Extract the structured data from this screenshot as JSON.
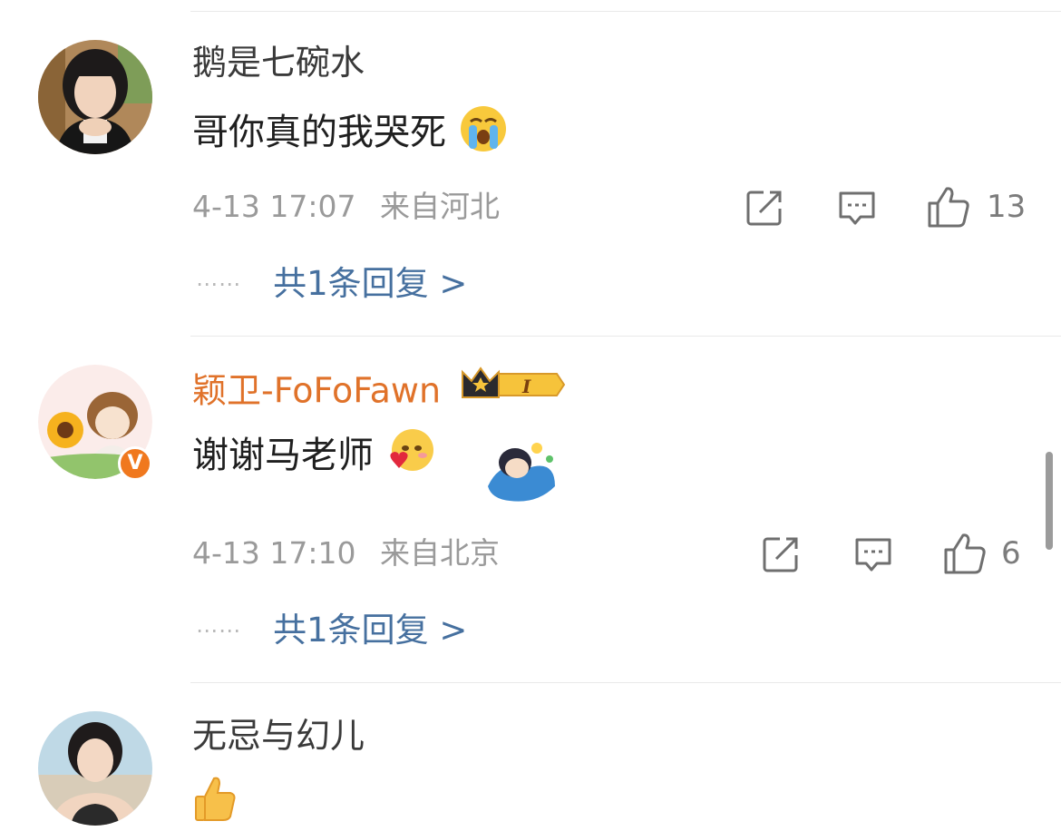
{
  "comments": [
    {
      "username": "鹅是七碗水",
      "text": "哥你真的我哭死",
      "emoji": "loudly-crying-face",
      "time": "4-13 17:07",
      "location": "来自河北",
      "likes": "13",
      "replies": "共1条回复 >"
    },
    {
      "username": "颖卫-FoFoFawn",
      "text": "谢谢马老师",
      "emoji": "blushing-heart-face",
      "time": "4-13 17:10",
      "location": "来自北京",
      "likes": "6",
      "replies": "共1条回复 >",
      "badge_text": "I",
      "verified_text": "V"
    },
    {
      "username": "无忌与幻儿",
      "emoji": "thumbs-up"
    }
  ],
  "colors": {
    "username_default": "#3a3a3a",
    "username_vip": "#e0722a",
    "reply_link": "#46709f",
    "meta": "#9a9a9a",
    "verified_badge": "#f0781e"
  }
}
